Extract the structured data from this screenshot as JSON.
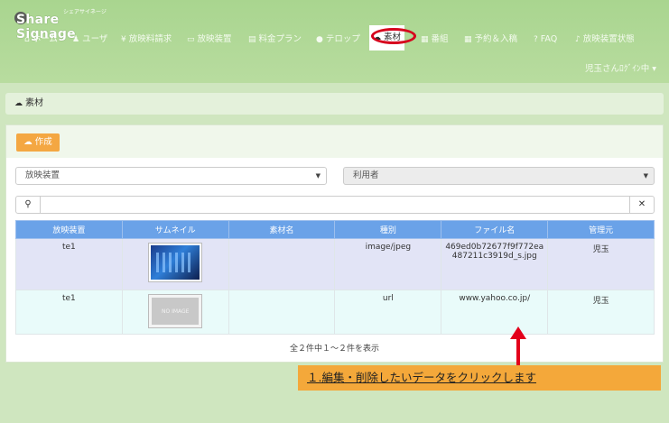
{
  "app": {
    "logo_text": "Share Signage",
    "logo_sub": "シェアサイネージ"
  },
  "nav": {
    "items": [
      {
        "icon": "home-icon",
        "glyph": "⌂",
        "label": "ホーム"
      },
      {
        "icon": "users-icon",
        "glyph": "♟",
        "label": "ユーザ"
      },
      {
        "icon": "yen-icon",
        "glyph": "¥",
        "label": "放映料請求"
      },
      {
        "icon": "monitor-icon",
        "glyph": "▭",
        "label": "放映装置"
      },
      {
        "icon": "card-icon",
        "glyph": "▤",
        "label": "料金プラン"
      },
      {
        "icon": "comment-icon",
        "glyph": "●",
        "label": "テロップ"
      },
      {
        "icon": "cloud-upload-icon",
        "glyph": "☁",
        "label": "素材"
      },
      {
        "icon": "film-icon",
        "glyph": "▦",
        "label": "番組"
      },
      {
        "icon": "calendar-icon",
        "glyph": "▦",
        "label": "予約＆入稿"
      },
      {
        "icon": "question-icon",
        "glyph": "?",
        "label": "FAQ"
      },
      {
        "icon": "bell-icon",
        "glyph": "♪",
        "label": "放映装置状態"
      }
    ],
    "active_index": 6,
    "user_menu": "児玉さんﾛｸﾞｲﾝ中 ▾"
  },
  "breadcrumb": {
    "icon": "cloud-upload-icon",
    "label": "素材"
  },
  "toolbar": {
    "create_label": "作成"
  },
  "filters": {
    "device_select": "放映装置",
    "user_select": "利用者",
    "search_value": ""
  },
  "table": {
    "headers": [
      "放映装置",
      "サムネイル",
      "素材名",
      "種別",
      "ファイル名",
      "管理元"
    ],
    "rows": [
      {
        "device": "te1",
        "thumbnail": "image",
        "name": "",
        "type": "image/jpeg",
        "file": "469ed0b72677f9f772ea487211c3919d_s.jpg",
        "owner": "児玉"
      },
      {
        "device": "te1",
        "thumbnail": "NO IMAGE",
        "name": "",
        "type": "url",
        "file": "www.yahoo.co.jp/",
        "owner": "児玉"
      }
    ]
  },
  "pager": {
    "summary": "全２件中１～２件を表示"
  },
  "annotation": {
    "callout": "１.編集・削除したいデータをクリックします",
    "highlight_color": "#e3001b"
  }
}
